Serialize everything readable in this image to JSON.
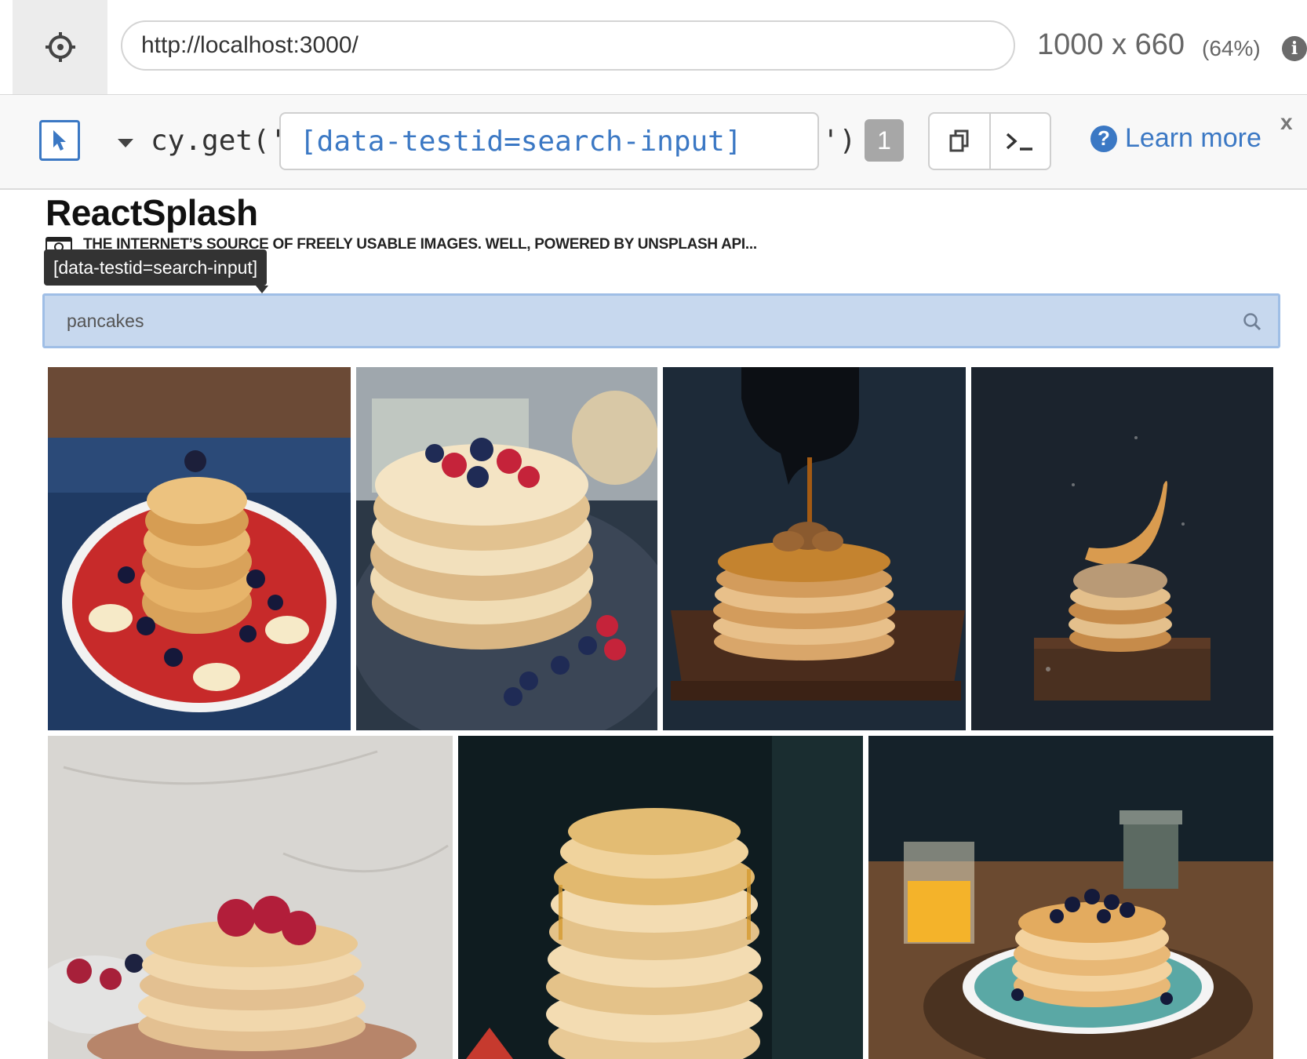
{
  "urlbar": {
    "url": "http://localhost:3000/",
    "viewport_size": "1000 x 660",
    "viewport_percent": "(64%)"
  },
  "playground": {
    "method_text": "cy.get('",
    "selector": "[data-testid=search-input]",
    "method_close": "')",
    "match_count": "1",
    "learn_more": "Learn more",
    "close_label": "x"
  },
  "app": {
    "title": "ReactSplash",
    "tagline": "THE INTERNET’S SOURCE OF FREELY USABLE IMAGES. WELL, POWERED BY UNSPLASH API...",
    "tooltip": "[data-testid=search-input]",
    "search_value": "pancakes"
  },
  "images": [
    {
      "icon": "pancakes-red-plate-photo"
    },
    {
      "icon": "pancakes-berries-photo"
    },
    {
      "icon": "pancakes-syrup-pour-photo"
    },
    {
      "icon": "pancake-flip-photo"
    },
    {
      "icon": "pancakes-raspberries-photo"
    },
    {
      "icon": "pancakes-honey-stack-photo"
    },
    {
      "icon": "pancakes-blueberries-table-photo"
    }
  ],
  "colors": {
    "accent": "#3b78c4",
    "search_bg": "#c7d8ee",
    "tooltip_bg": "#333333"
  }
}
